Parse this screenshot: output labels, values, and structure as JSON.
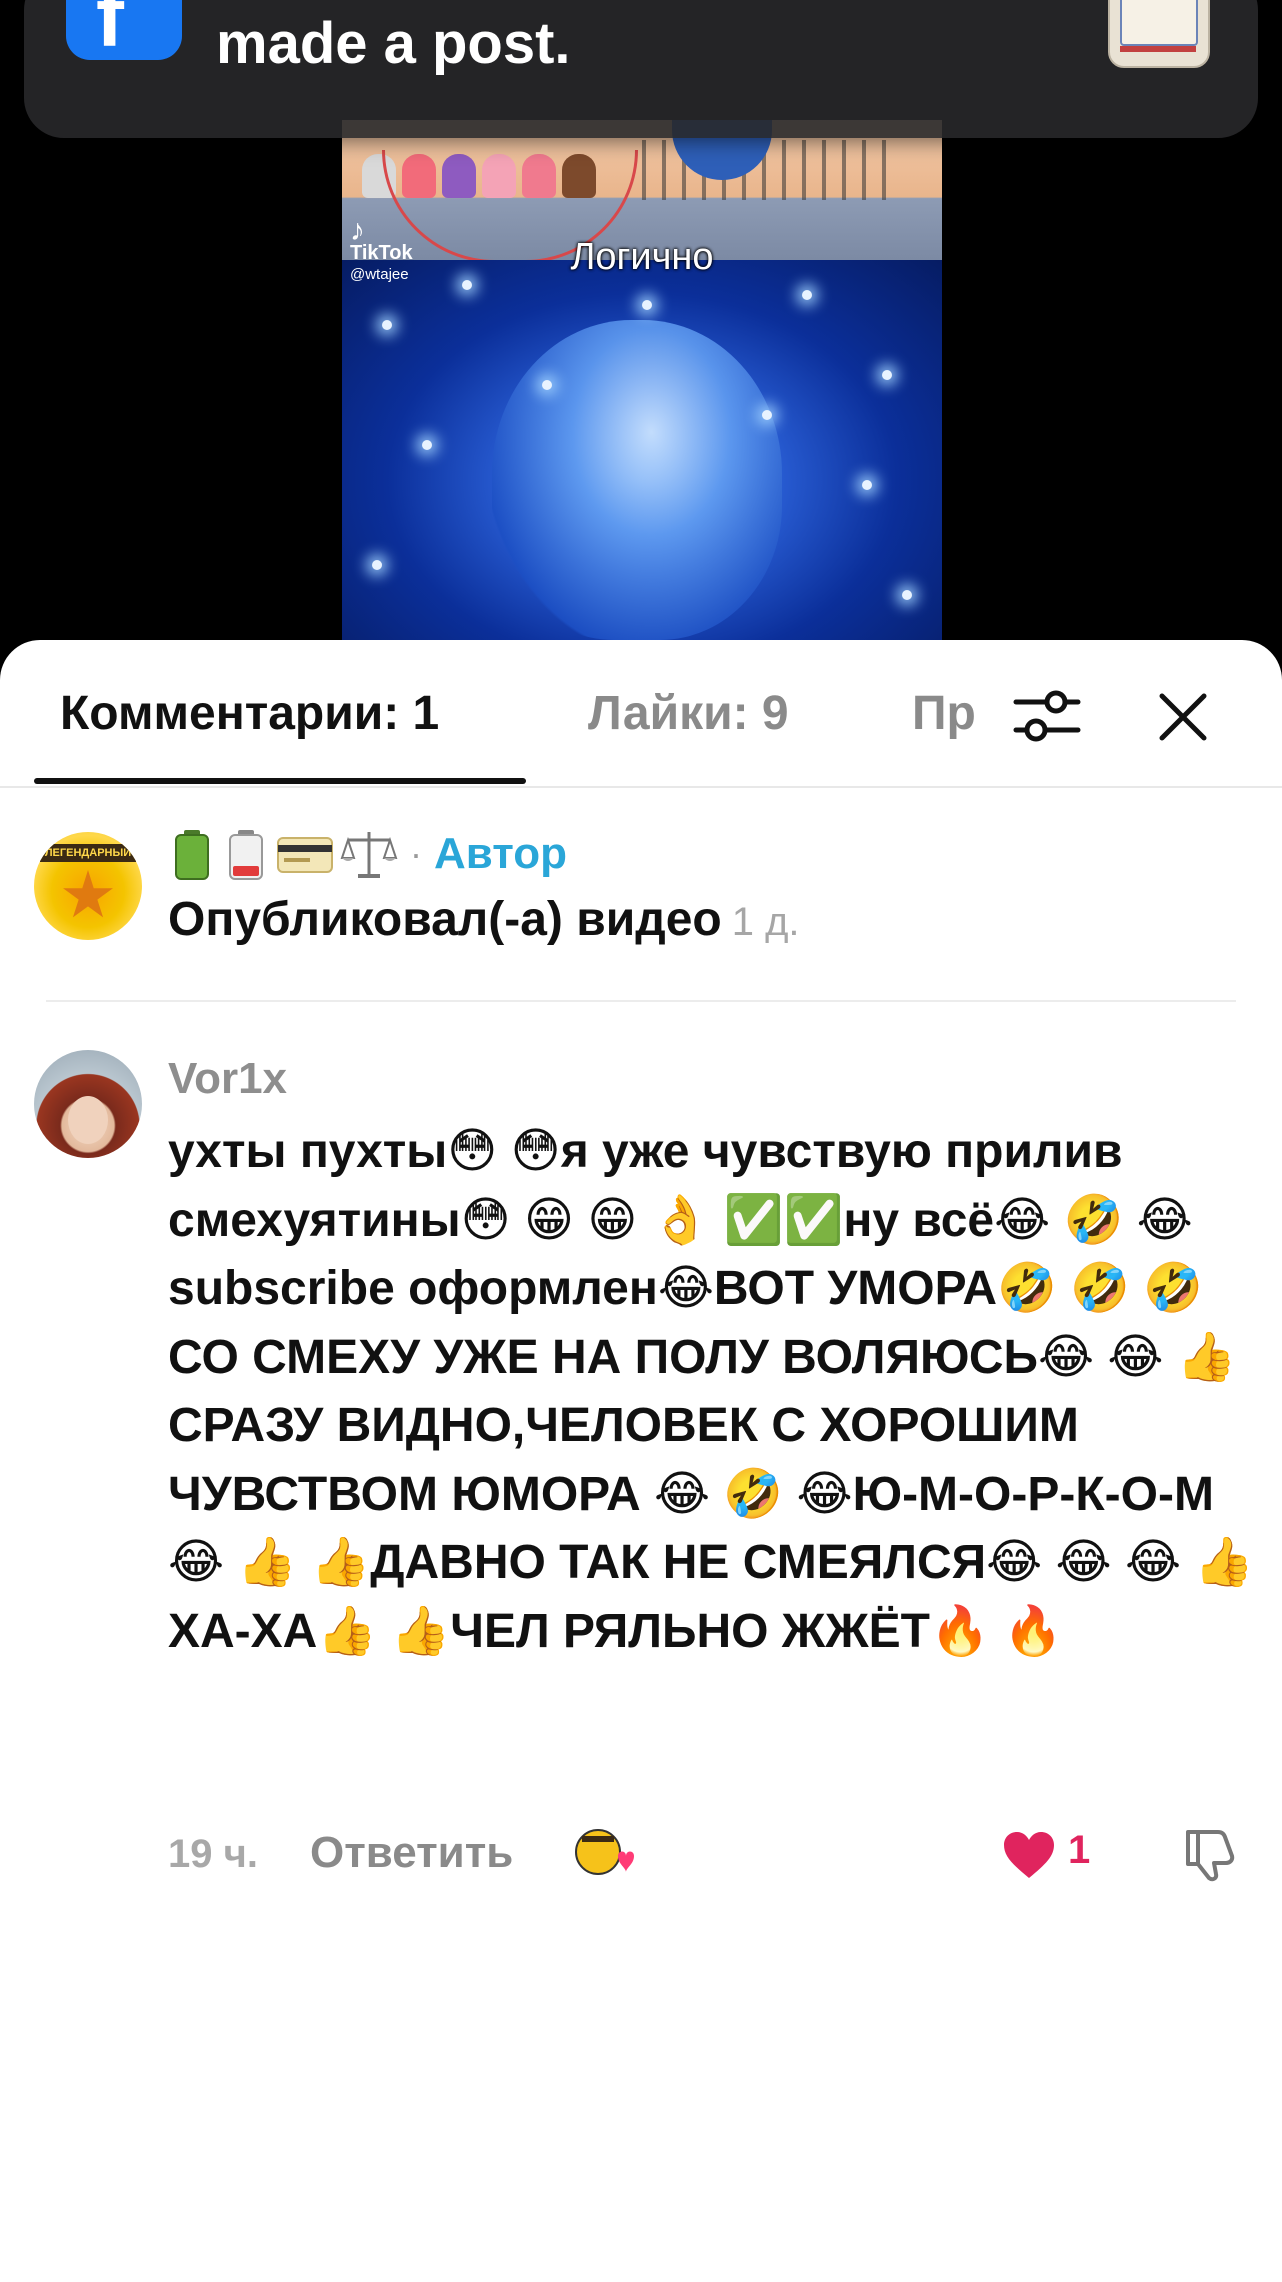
{
  "notification": {
    "text": "made a post.",
    "app_icon": "facebook-icon"
  },
  "video": {
    "caption": "Логично",
    "watermark": "TikTok",
    "handle": "@wtajee"
  },
  "tabs": {
    "comments": "Комментарии: 1",
    "likes": "Лайки: 9",
    "truncated": "Пр"
  },
  "author_entry": {
    "badge": "Автор",
    "dot": "·",
    "action": "Опубликовал(-а) видео",
    "time": "1 д.",
    "avatar_banner": "ЛЕГЕНДАРНЫЙ",
    "emojis": [
      "battery-full-icon",
      "battery-low-icon",
      "credit-card-icon",
      "scales-icon"
    ]
  },
  "comment": {
    "username": "Vor1x",
    "text": "ухты пухты😳 😳я уже чувствую прилив смехуятины😳 😁 😁 👌 ✅✅ну всё😂 🤣 😂 subscribe оформлен😂ВОТ УМОРА🤣 🤣 🤣СО СМЕХУ УЖЕ НА ПОЛУ ВОЛЯЮСЬ😂 😂 👍СРАЗУ ВИДНО,ЧЕЛОВЕК С ХОРОШИМ ЧУВСТВОМ ЮМОРА 😂 🤣 😂Ю-М-О-Р-К-О-М😂 👍 👍ДАВНО ТАК НЕ СМЕЯЛСЯ😂 😂 😂 👍ХА-ХА👍 👍ЧЕЛ РЯЛЬНО ЖЖЁТ🔥 🔥",
    "time": "19 ч.",
    "reply_label": "Ответить",
    "like_count": "1"
  },
  "colors": {
    "author_badge": "#2aa6d8",
    "like_red": "#e0245e",
    "facebook_blue": "#1877f2"
  }
}
